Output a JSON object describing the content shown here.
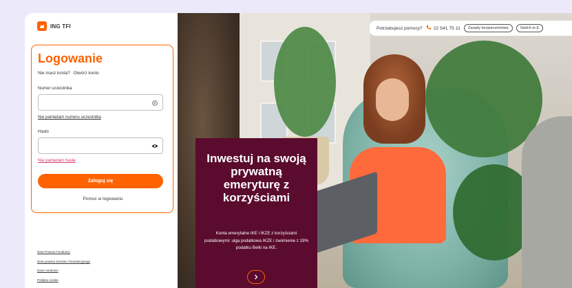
{
  "brand": {
    "name": "ING TFI",
    "accent": "#ff6200",
    "promo_bg": "#5a0b2e"
  },
  "login": {
    "title": "Logowanie",
    "no_account": "Nie masz konta?",
    "open_account": "Otwórz konto",
    "participant_label": "Numer uczestnika",
    "participant_value": "",
    "forgot_participant": "Nie pamiętam numeru uczestnika",
    "password_label": "Hasło",
    "password_value": "",
    "forgot_password": "Nie pamiętam hasła",
    "login_button": "Zaloguj się",
    "help": "Pomoc w logowaniu"
  },
  "footer": {
    "links": [
      "Nota Prawna Funduszy",
      "Nota prawna Serwisu Transakcyjnego",
      "Dane osobowe",
      "Polityka cookie"
    ]
  },
  "topbar": {
    "help_question": "Potrzebujesz pomocy?",
    "phone": "22 541 75 11",
    "security_button": "Zasady bezpieczeństwa",
    "switch_button": "Switch to E"
  },
  "promo": {
    "title": "Inwestuj na swoją prywatną emeryturę z korzyściami",
    "text": "Konta emerytalne IKE i IKZE z korzyściami podatkowymi: ulga podatkowa IKZE i zwolnienie z 19% podatku Belki na IKE."
  },
  "icons": {
    "participant_field": "info-icon",
    "password_field": "eye-icon",
    "phone": "phone-icon",
    "promo_arrow": "chevron-right-icon"
  }
}
